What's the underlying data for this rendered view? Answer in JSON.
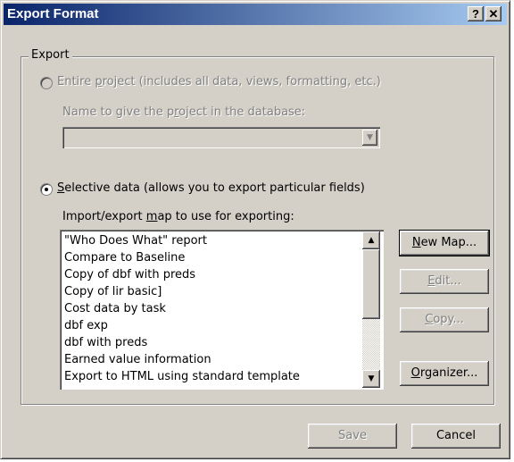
{
  "window": {
    "title": "Export Format",
    "help_button": "?",
    "close_button": "✕"
  },
  "export_group": {
    "legend": "Export",
    "entire_project": {
      "label_prefix": "Entire ",
      "label_underlined": "p",
      "label_rest": "roject (includes all data, views, formatting, etc.)",
      "selected": false,
      "enabled": false
    },
    "name_label": {
      "prefix": "Name to give the p",
      "underlined": "r",
      "rest": "oject in the database:"
    },
    "name_combo": {
      "value": "",
      "arrow": "▼"
    },
    "selective_data": {
      "label_prefix": "",
      "label_underlined": "S",
      "label_rest": "elective data (allows you to export particular fields)",
      "selected": true,
      "enabled": true
    },
    "map_label": {
      "prefix": "Import/export ",
      "underlined": "m",
      "rest": "ap to use for exporting:"
    },
    "maps": [
      "\"Who Does What\" report",
      "Compare to Baseline",
      "Copy of dbf with preds",
      "Copy of lir basic]",
      "Cost data by task",
      "dbf exp",
      "dbf with preds",
      "Earned value information",
      "Export to HTML using standard template"
    ],
    "scroll": {
      "up": "▲",
      "down": "▼"
    }
  },
  "side_buttons": {
    "new_map": {
      "underlined": "N",
      "rest": "ew Map..."
    },
    "edit": {
      "underlined": "E",
      "rest": "dit..."
    },
    "copy": {
      "underlined": "C",
      "rest": "opy..."
    },
    "organizer": {
      "underlined": "O",
      "rest": "rganizer..."
    }
  },
  "footer": {
    "save": "Save",
    "cancel": "Cancel"
  }
}
